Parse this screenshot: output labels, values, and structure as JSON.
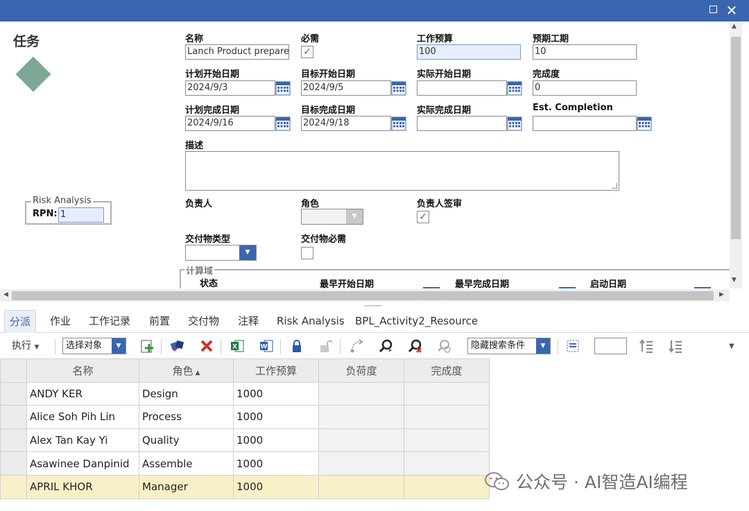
{
  "window": {
    "maximize_label": "",
    "close_label": "✕"
  },
  "page": {
    "title": "任务"
  },
  "fields": {
    "name": {
      "label": "名称",
      "value": "Lanch Product prepare t"
    },
    "required": {
      "label": "必需",
      "checked": true
    },
    "work_budget": {
      "label": "工作预算",
      "value": "100"
    },
    "expected_duration": {
      "label": "预期工期",
      "value": "10"
    },
    "plan_start": {
      "label": "计划开始日期",
      "value": "2024/9/3"
    },
    "target_start": {
      "label": "目标开始日期",
      "value": "2024/9/5"
    },
    "actual_start": {
      "label": "实际开始日期",
      "value": ""
    },
    "completion": {
      "label": "完成度",
      "value": "0"
    },
    "plan_finish": {
      "label": "计划完成日期",
      "value": "2024/9/16"
    },
    "target_finish": {
      "label": "目标完成日期",
      "value": "2024/9/18"
    },
    "actual_finish": {
      "label": "实际完成日期",
      "value": ""
    },
    "est_completion": {
      "label": "Est. Completion",
      "value": ""
    },
    "description": {
      "label": "描述",
      "value": ""
    },
    "owner": {
      "label": "负责人"
    },
    "role": {
      "label": "角色",
      "value": ""
    },
    "owner_signoff": {
      "label": "负责人签审",
      "checked": true
    },
    "deliverable_type": {
      "label": "交付物类型",
      "value": ""
    },
    "deliverable_required": {
      "label": "交付物必需",
      "checked": false
    }
  },
  "risk": {
    "legend": "Risk Analysis",
    "rpn_label": "RPN:",
    "rpn_value": "1"
  },
  "calc": {
    "legend": "计算域",
    "status": "状态",
    "earliest_start": "最早开始日期",
    "earliest_finish": "最早完成日期",
    "launch_date": "启动日期"
  },
  "tabs": [
    "分派",
    "作业",
    "工作记录",
    "前置",
    "交付物",
    "注释",
    "Risk Analysis",
    "BPL_Activity2_Resource"
  ],
  "toolbar": {
    "execute_label": "执行",
    "select_object": "选择对象",
    "hide_search": "隐藏搜索条件"
  },
  "grid": {
    "columns": [
      "名称",
      "角色",
      "工作预算",
      "负荷度",
      "完成度"
    ],
    "rows": [
      {
        "name": "ANDY KER",
        "role": "Design",
        "budget": "1000",
        "load": "",
        "completion": ""
      },
      {
        "name": "Alice Soh Pih Lin",
        "role": "Process",
        "budget": "1000",
        "load": "",
        "completion": ""
      },
      {
        "name": "Alex Tan Kay Yi",
        "role": "Quality",
        "budget": "1000",
        "load": "",
        "completion": ""
      },
      {
        "name": "Asawinee Danpinid",
        "role": "Assemble",
        "budget": "1000",
        "load": "",
        "completion": ""
      },
      {
        "name": "APRIL KHOR",
        "role": "Manager",
        "budget": "1000",
        "load": "",
        "completion": ""
      }
    ]
  },
  "watermark": {
    "text": "公众号 · AI智造AI编程"
  },
  "colors": {
    "accent": "#3a66b0",
    "selected_row": "#faf0c8",
    "diamond": "#7ca895"
  }
}
